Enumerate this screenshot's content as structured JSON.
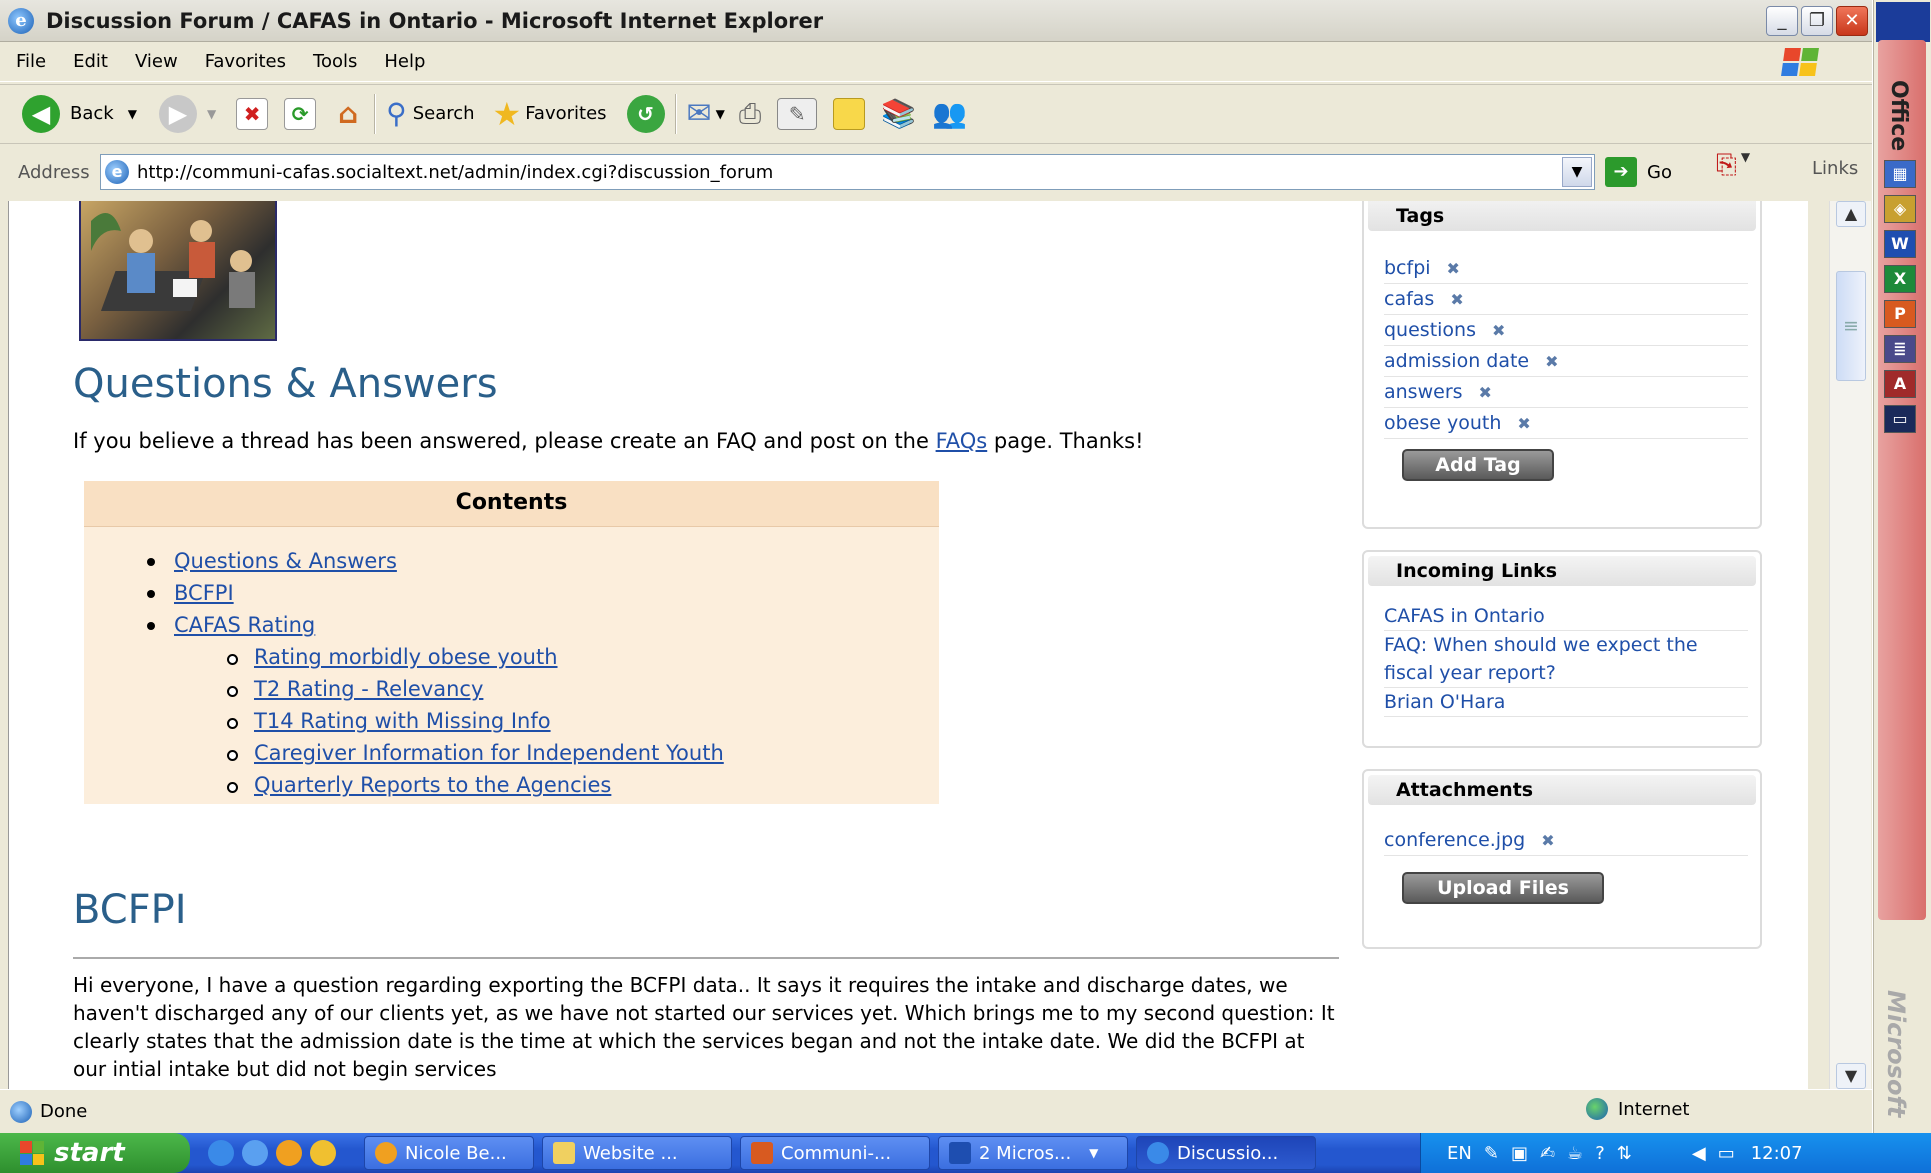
{
  "window": {
    "title": "Discussion Forum / CAFAS in Ontario - Microsoft Internet Explorer"
  },
  "menu": [
    "File",
    "Edit",
    "View",
    "Favorites",
    "Tools",
    "Help"
  ],
  "toolbar": {
    "back": "Back",
    "search": "Search",
    "favorites": "Favorites"
  },
  "address": {
    "label": "Address",
    "url": "http://communi-cafas.socialtext.net/admin/index.cgi?discussion_forum",
    "go": "Go",
    "links": "Links"
  },
  "page": {
    "heading": "Questions & Answers",
    "intro_before": "If you believe a thread has been answered, please create an FAQ and post on the ",
    "intro_link": "FAQs",
    "intro_after": " page. Thanks!",
    "contents_title": "Contents",
    "contents": [
      {
        "label": "Questions & Answers",
        "level": 1
      },
      {
        "label": "BCFPI",
        "level": 1
      },
      {
        "label": "CAFAS Rating",
        "level": 1
      },
      {
        "label": "Rating morbidly obese youth",
        "level": 2
      },
      {
        "label": "T2 Rating - Relevancy",
        "level": 2
      },
      {
        "label": "T14 Rating with Missing Info",
        "level": 2
      },
      {
        "label": "Caregiver Information for Independent Youth",
        "level": 2
      },
      {
        "label": "Quarterly Reports to the Agencies",
        "level": 2
      }
    ],
    "section_heading": "BCFPI",
    "section_body": "Hi everyone, I have a question regarding exporting the BCFPI data.. It says it requires the intake and discharge dates, we haven't discharged any of our clients yet, as we have not started our services yet. Which brings me to my second question: It clearly states that the admission date is the time at which the services began and not the intake date. We did the BCFPI at our intial intake but did not begin services"
  },
  "sidebar": {
    "tags_title": "Tags",
    "tags": [
      "bcfpi",
      "cafas",
      "questions",
      "admission date",
      "answers",
      "obese youth"
    ],
    "add_tag": "Add Tag",
    "incoming_title": "Incoming Links",
    "incoming": [
      "CAFAS in Ontario",
      "FAQ: When should we expect the fiscal year report?",
      "Brian O'Hara"
    ],
    "attachments_title": "Attachments",
    "attachments": [
      "conference.jpg"
    ],
    "upload": "Upload Files"
  },
  "status": {
    "text": "Done",
    "zone": "Internet"
  },
  "officebar": {
    "label": "Office",
    "brand": "Microsoft"
  },
  "taskbar": {
    "start": "start",
    "tasks": [
      "Nicole Be...",
      "Website ...",
      "Communi-...",
      "2 Micros...",
      "Discussio..."
    ],
    "lang": "EN",
    "clock": "12:07"
  }
}
